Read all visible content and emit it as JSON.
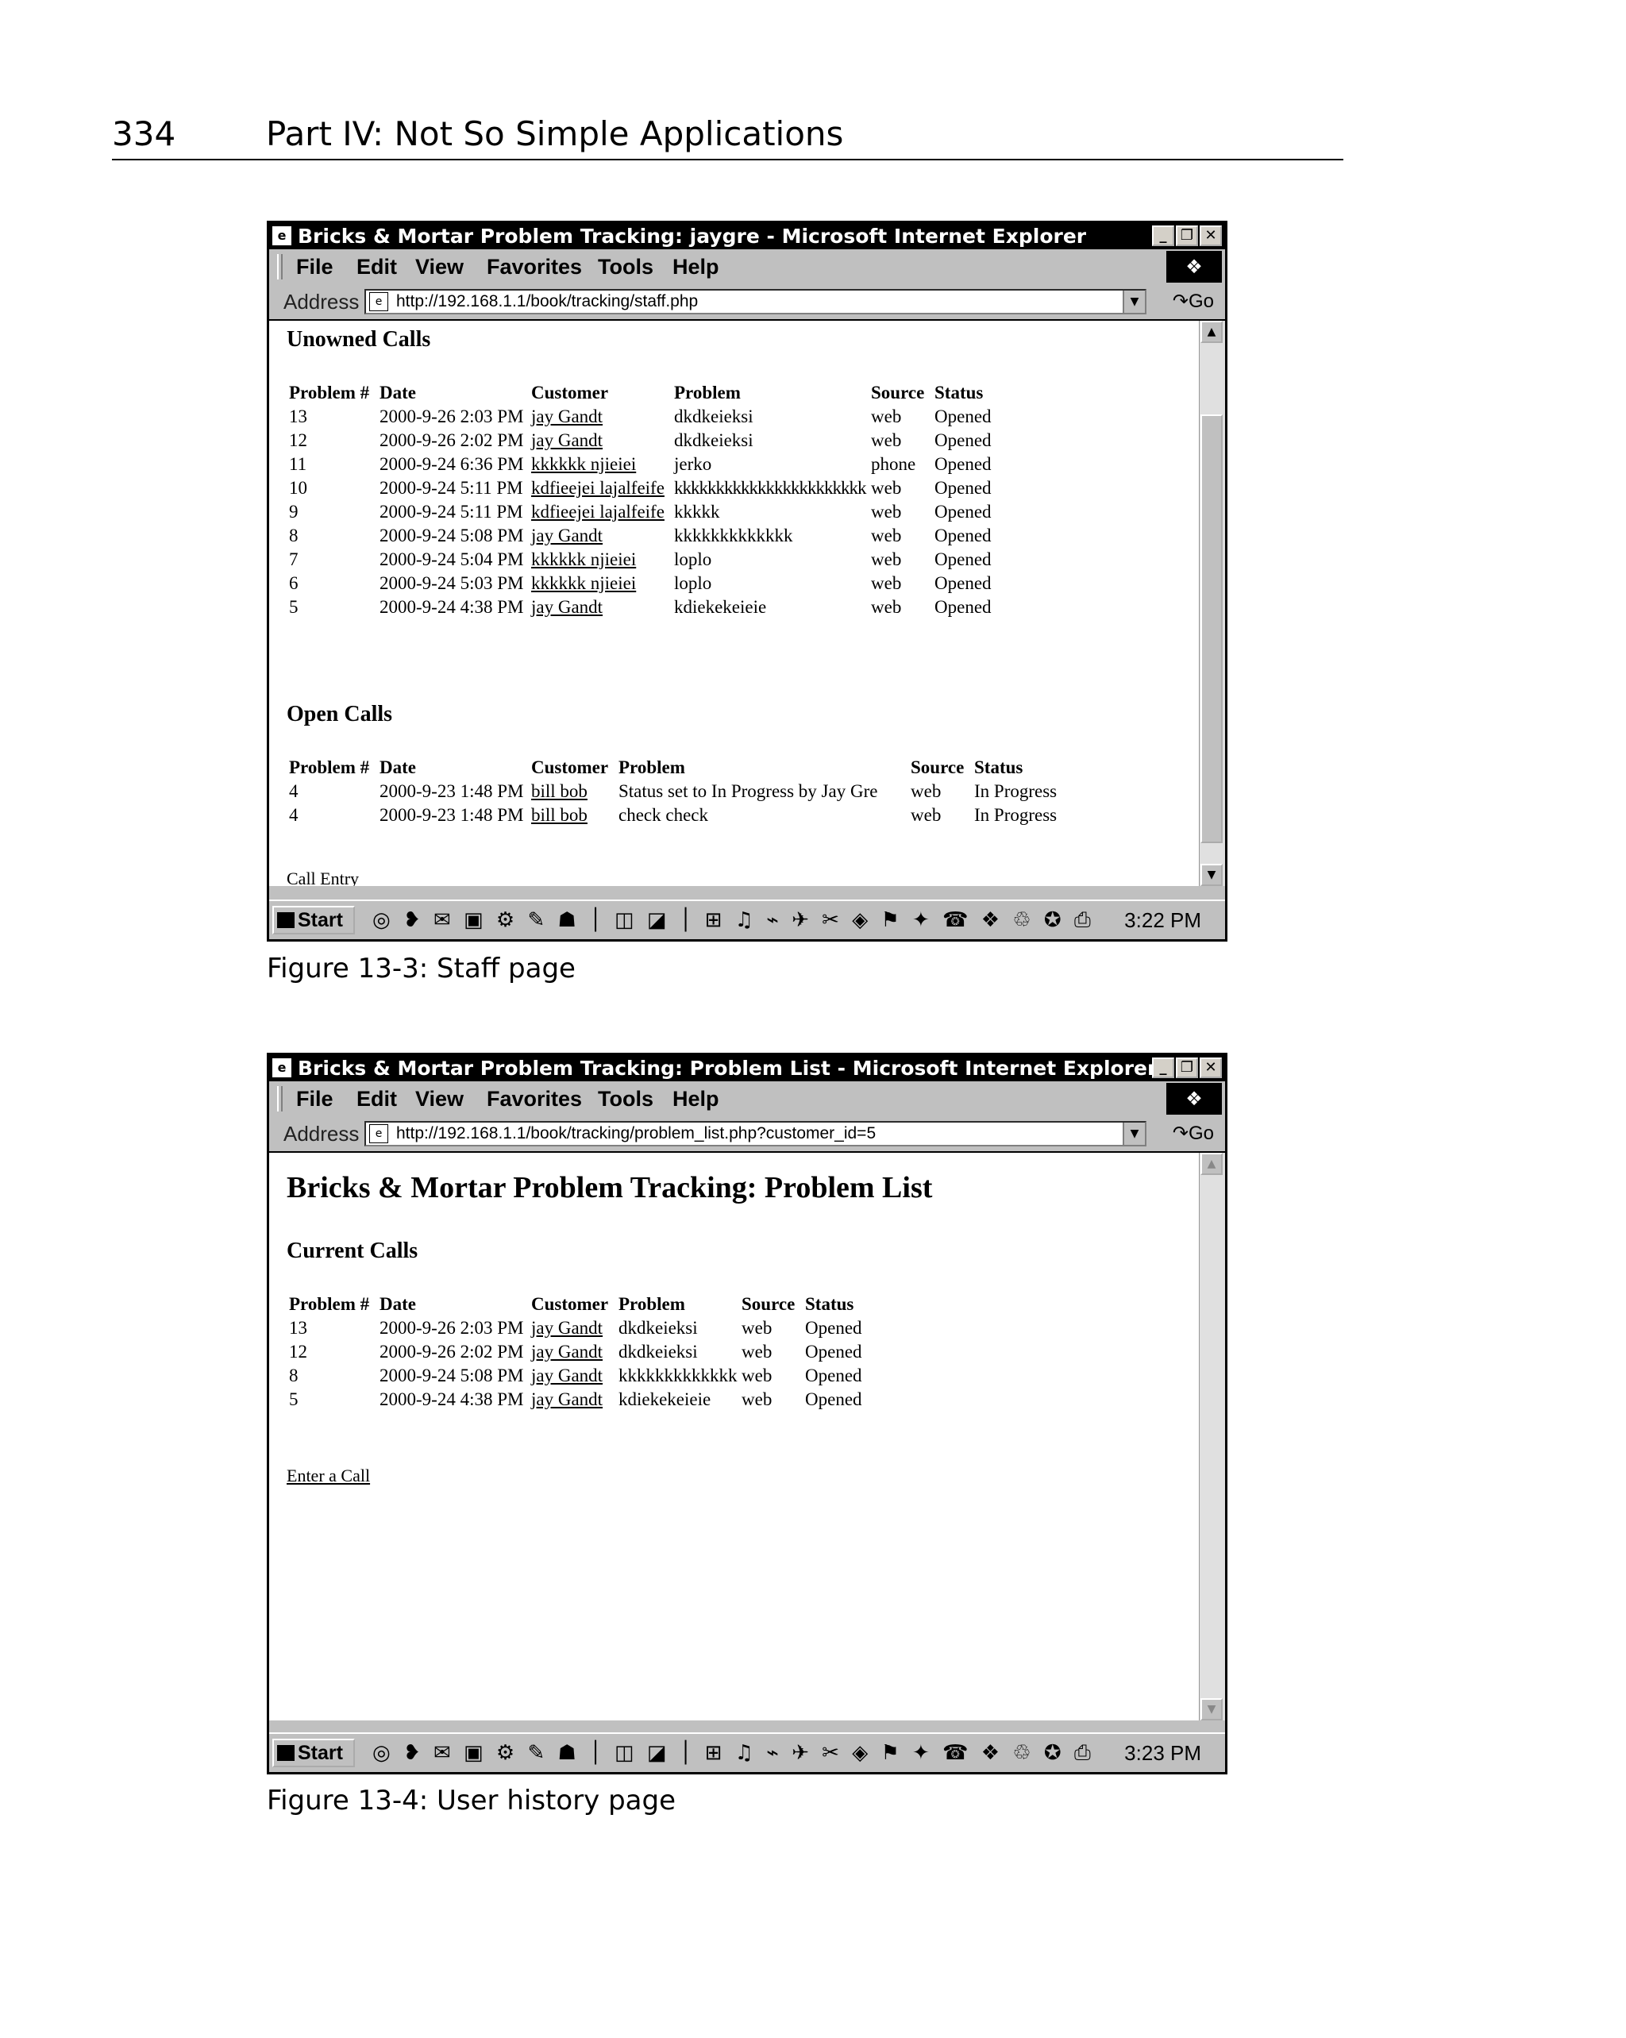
{
  "page": {
    "number": "334",
    "chapter": "Part IV: Not So Simple Applications"
  },
  "figures": [
    {
      "window_title": "Bricks & Mortar Problem Tracking: jaygre - Microsoft Internet Explorer",
      "menu": [
        "File",
        "Edit",
        "View",
        "Favorites",
        "Tools",
        "Help"
      ],
      "address_label": "Address",
      "address_url": "http://192.168.1.1/book/tracking/staff.php",
      "go_label": "Go",
      "sections": [
        {
          "heading": "Unowned Calls",
          "headers": [
            "Problem #",
            "Date",
            "Customer",
            "Problem",
            "Source",
            "Status"
          ],
          "rows": [
            [
              "13",
              "2000-9-26 2:03 PM",
              "jay Gandt",
              "dkdkeieksi",
              "web",
              "Opened"
            ],
            [
              "12",
              "2000-9-26 2:02 PM",
              "jay Gandt",
              "dkdkeieksi",
              "web",
              "Opened"
            ],
            [
              "11",
              "2000-9-24 6:36 PM",
              "kkkkkk njieiei",
              "jerko",
              "phone",
              "Opened"
            ],
            [
              "10",
              "2000-9-24 5:11 PM",
              "kdfieejei lajalfeife",
              "kkkkkkkkkkkkkkkkkkkkkkk",
              "web",
              "Opened"
            ],
            [
              "9",
              "2000-9-24 5:11 PM",
              "kdfieejei lajalfeife",
              "kkkkk",
              "web",
              "Opened"
            ],
            [
              "8",
              "2000-9-24 5:08 PM",
              "jay Gandt",
              "kkkkkkkkkkkkk",
              "web",
              "Opened"
            ],
            [
              "7",
              "2000-9-24 5:04 PM",
              "kkkkkk njieiei",
              "loplo",
              "web",
              "Opened"
            ],
            [
              "6",
              "2000-9-24 5:03 PM",
              "kkkkkk njieiei",
              "loplo",
              "web",
              "Opened"
            ],
            [
              "5",
              "2000-9-24 4:38 PM",
              "jay Gandt",
              "kdiekekeieie",
              "web",
              "Opened"
            ]
          ]
        },
        {
          "heading": "Open Calls",
          "headers": [
            "Problem #",
            "Date",
            "Customer",
            "Problem",
            "Source",
            "Status"
          ],
          "rows": [
            [
              "4",
              "2000-9-23 1:48 PM",
              "bill bob",
              "Status set to In Progress by Jay Gre",
              "web",
              "In Progress"
            ],
            [
              "4",
              "2000-9-23 1:48 PM",
              "bill bob",
              "check check",
              "web",
              "In Progress"
            ]
          ]
        }
      ],
      "footer_link": "Call Entry",
      "taskbar": {
        "start": "Start",
        "clock": "3:22 PM"
      },
      "caption": "Figure 13-3: Staff page"
    },
    {
      "window_title": "Bricks & Mortar Problem Tracking: Problem List - Microsoft Internet Explorer",
      "menu": [
        "File",
        "Edit",
        "View",
        "Favorites",
        "Tools",
        "Help"
      ],
      "address_label": "Address",
      "address_url": "http://192.168.1.1/book/tracking/problem_list.php?customer_id=5",
      "go_label": "Go",
      "page_heading": "Bricks & Mortar Problem Tracking: Problem List",
      "sections": [
        {
          "heading": "Current Calls",
          "headers": [
            "Problem #",
            "Date",
            "Customer",
            "Problem",
            "Source",
            "Status"
          ],
          "rows": [
            [
              "13",
              "2000-9-26 2:03 PM",
              "jay Gandt",
              "dkdkeieksi",
              "web",
              "Opened"
            ],
            [
              "12",
              "2000-9-26 2:02 PM",
              "jay Gandt",
              "dkdkeieksi",
              "web",
              "Opened"
            ],
            [
              "8",
              "2000-9-24 5:08 PM",
              "jay Gandt",
              "kkkkkkkkkkkkk",
              "web",
              "Opened"
            ],
            [
              "5",
              "2000-9-24 4:38 PM",
              "jay Gandt",
              "kdiekekeieie",
              "web",
              "Opened"
            ]
          ]
        }
      ],
      "footer_link": "Enter a Call",
      "taskbar": {
        "start": "Start",
        "clock": "3:23 PM"
      },
      "caption": "Figure 13-4: User history page"
    }
  ]
}
